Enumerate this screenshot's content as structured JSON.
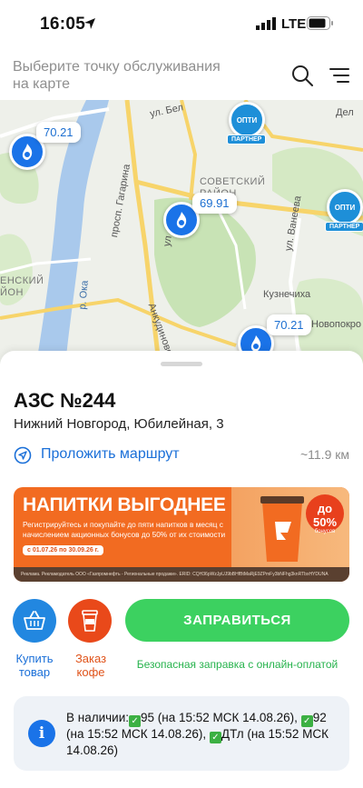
{
  "status_bar": {
    "time": "16:05",
    "network": "LTE"
  },
  "header": {
    "prompt": "Выберите точку обслуживания на карте",
    "search_icon": "search-icon",
    "menu_icon": "menu-icon"
  },
  "map": {
    "labels": {
      "street_1": "ул. Бел",
      "street_2": "Дел",
      "district_soviet": "СОВЕТСКИЙ РАЙОН",
      "gagarin": "просп. Гагарина",
      "vaneeva": "ул. Ванеева",
      "river": "р. Ока",
      "kuznechikha": "Кузнечиха",
      "novopokrov": "Новопокро",
      "district_left": "ЕНСКИЙ ЙОН",
      "ankudinov": "Анкудиновское",
      "ul_short": "ул"
    },
    "price_tags": [
      "70.21",
      "69.91",
      "70.21"
    ],
    "opti": {
      "label": "ОПТИ",
      "tag": "ПАРТНЕР"
    }
  },
  "station": {
    "title": "АЗС №244",
    "address": "Нижний Новгород, Юбилейная, 3",
    "route_label": "Проложить маршрут",
    "distance": "~11.9 км"
  },
  "promo": {
    "title": "НАПИТКИ ВЫГОДНЕЕ",
    "text": "Регистрируйтесь и покупайте до пяти напитков в месяц с начислением акционных бонусов до 50% от их стоимости",
    "dates": "с 01.07.26 по 30.09.26 г.",
    "badge_percent": "до 50%",
    "badge_sub": "бонусов",
    "legal": "Реклама. Рекламодатель ООО «Газпромнефть - Региональные продажи». ERID: CQH36pWzJpUJ9bBHfBtMaRjE9ZPmFy3bNFhg3knRTbxHYDUNA"
  },
  "actions": {
    "buy_label": "Купить товар",
    "coffee_label": "Заказ кофе",
    "refuel_label": "ЗАПРАВИТЬСЯ",
    "refuel_sub": "Безопасная заправка с онлайн-оплатой"
  },
  "availability": {
    "prefix": "В наличии:",
    "fuel_1": "95 (на 15:52 МСК 14.08.26),",
    "fuel_2": "92",
    "fuel_2_time": "(на 15:52 МСК 14.08.26),",
    "fuel_3": "ДТл (на 15:52 МСК",
    "fuel_3_date": "14.08.26)"
  },
  "colors": {
    "brand_blue": "#1a73e8",
    "green": "#3cd160",
    "orange": "#f26b21"
  }
}
